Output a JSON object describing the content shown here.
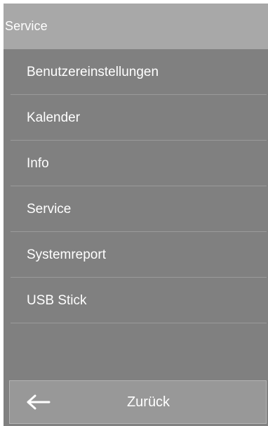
{
  "header": {
    "title": "Service"
  },
  "menu": {
    "items": [
      {
        "label": "Benutzereinstellungen"
      },
      {
        "label": "Kalender"
      },
      {
        "label": "Info"
      },
      {
        "label": "Service"
      },
      {
        "label": "Systemreport"
      },
      {
        "label": "USB Stick"
      }
    ]
  },
  "footer": {
    "back_label": "Zurück",
    "back_icon": "arrow-left-icon"
  },
  "colors": {
    "panel_background": "#808080",
    "header_background": "#a8a8a8",
    "button_background": "#989898",
    "text": "#ffffff"
  }
}
